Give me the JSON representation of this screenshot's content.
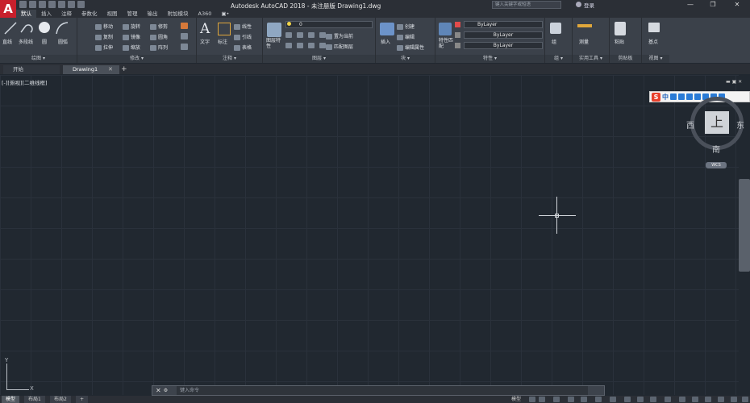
{
  "app": {
    "logo": "A",
    "title": "Autodesk AutoCAD 2018 - 未注册版    Drawing1.dwg",
    "search_placeholder": "键入关键字或短语",
    "signin": "登录",
    "window_controls": [
      "—",
      "❐",
      "✕"
    ]
  },
  "ribbon_tabs": [
    "默认",
    "插入",
    "注释",
    "参数化",
    "视图",
    "管理",
    "输出",
    "附加模块",
    "A360",
    "▣•"
  ],
  "panels": {
    "draw": {
      "footer": "绘图 ▾",
      "tools": [
        "直线",
        "多段线",
        "圆",
        "圆弧"
      ]
    },
    "modify": {
      "footer": "修改 ▾",
      "tools": [
        "移动",
        "旋转",
        "修剪",
        "复制",
        "镜像",
        "圆角",
        "拉伸",
        "缩放",
        "阵列"
      ]
    },
    "annotation": {
      "footer": "注释 ▾",
      "tools": [
        "文字",
        "标注",
        "线性",
        "引线",
        "表格"
      ]
    },
    "layers": {
      "footer": "图层 ▾",
      "tools": [
        "图层特性",
        "置为当前",
        "匹配图层"
      ],
      "current_layer": "0"
    },
    "block": {
      "footer": "块 ▾",
      "tools": [
        "插入",
        "创建",
        "编辑",
        "编辑属性"
      ]
    },
    "properties": {
      "footer": "特性 ▾",
      "tools": [
        "特性匹配"
      ],
      "color": "ByLayer",
      "linetype": "ByLayer",
      "lineweight": "ByLayer"
    },
    "groups": {
      "footer": "组 ▾",
      "tools": [
        "组"
      ]
    },
    "utilities": {
      "footer": "实用工具 ▾",
      "tools": [
        "测量"
      ]
    },
    "clipboard": {
      "footer": "剪贴板",
      "tools": [
        "粘贴"
      ]
    },
    "view": {
      "footer": "视图 ▾",
      "tools": [
        "基点"
      ]
    }
  },
  "file_tabs": [
    "开始",
    "Drawing1",
    "+"
  ],
  "viewport": {
    "label": "[-][俯视][二维线框]",
    "cube_face": "上",
    "compass": {
      "west": "西",
      "east": "东",
      "south": "南"
    },
    "wcs": "WCS"
  },
  "ime_toolbar": {
    "mode": "中"
  },
  "ucs": {
    "x": "X",
    "y": "Y"
  },
  "command_line": {
    "placeholder": "键入命令",
    "close": "✕",
    "tool": "🔧"
  },
  "layout_tabs": [
    "模型",
    "布局1",
    "布局2",
    "+"
  ],
  "status": {
    "model": "模型"
  },
  "colors": {
    "accent_red": "#c8202c",
    "canvas": "#212830",
    "ribbon": "#3b414a"
  }
}
